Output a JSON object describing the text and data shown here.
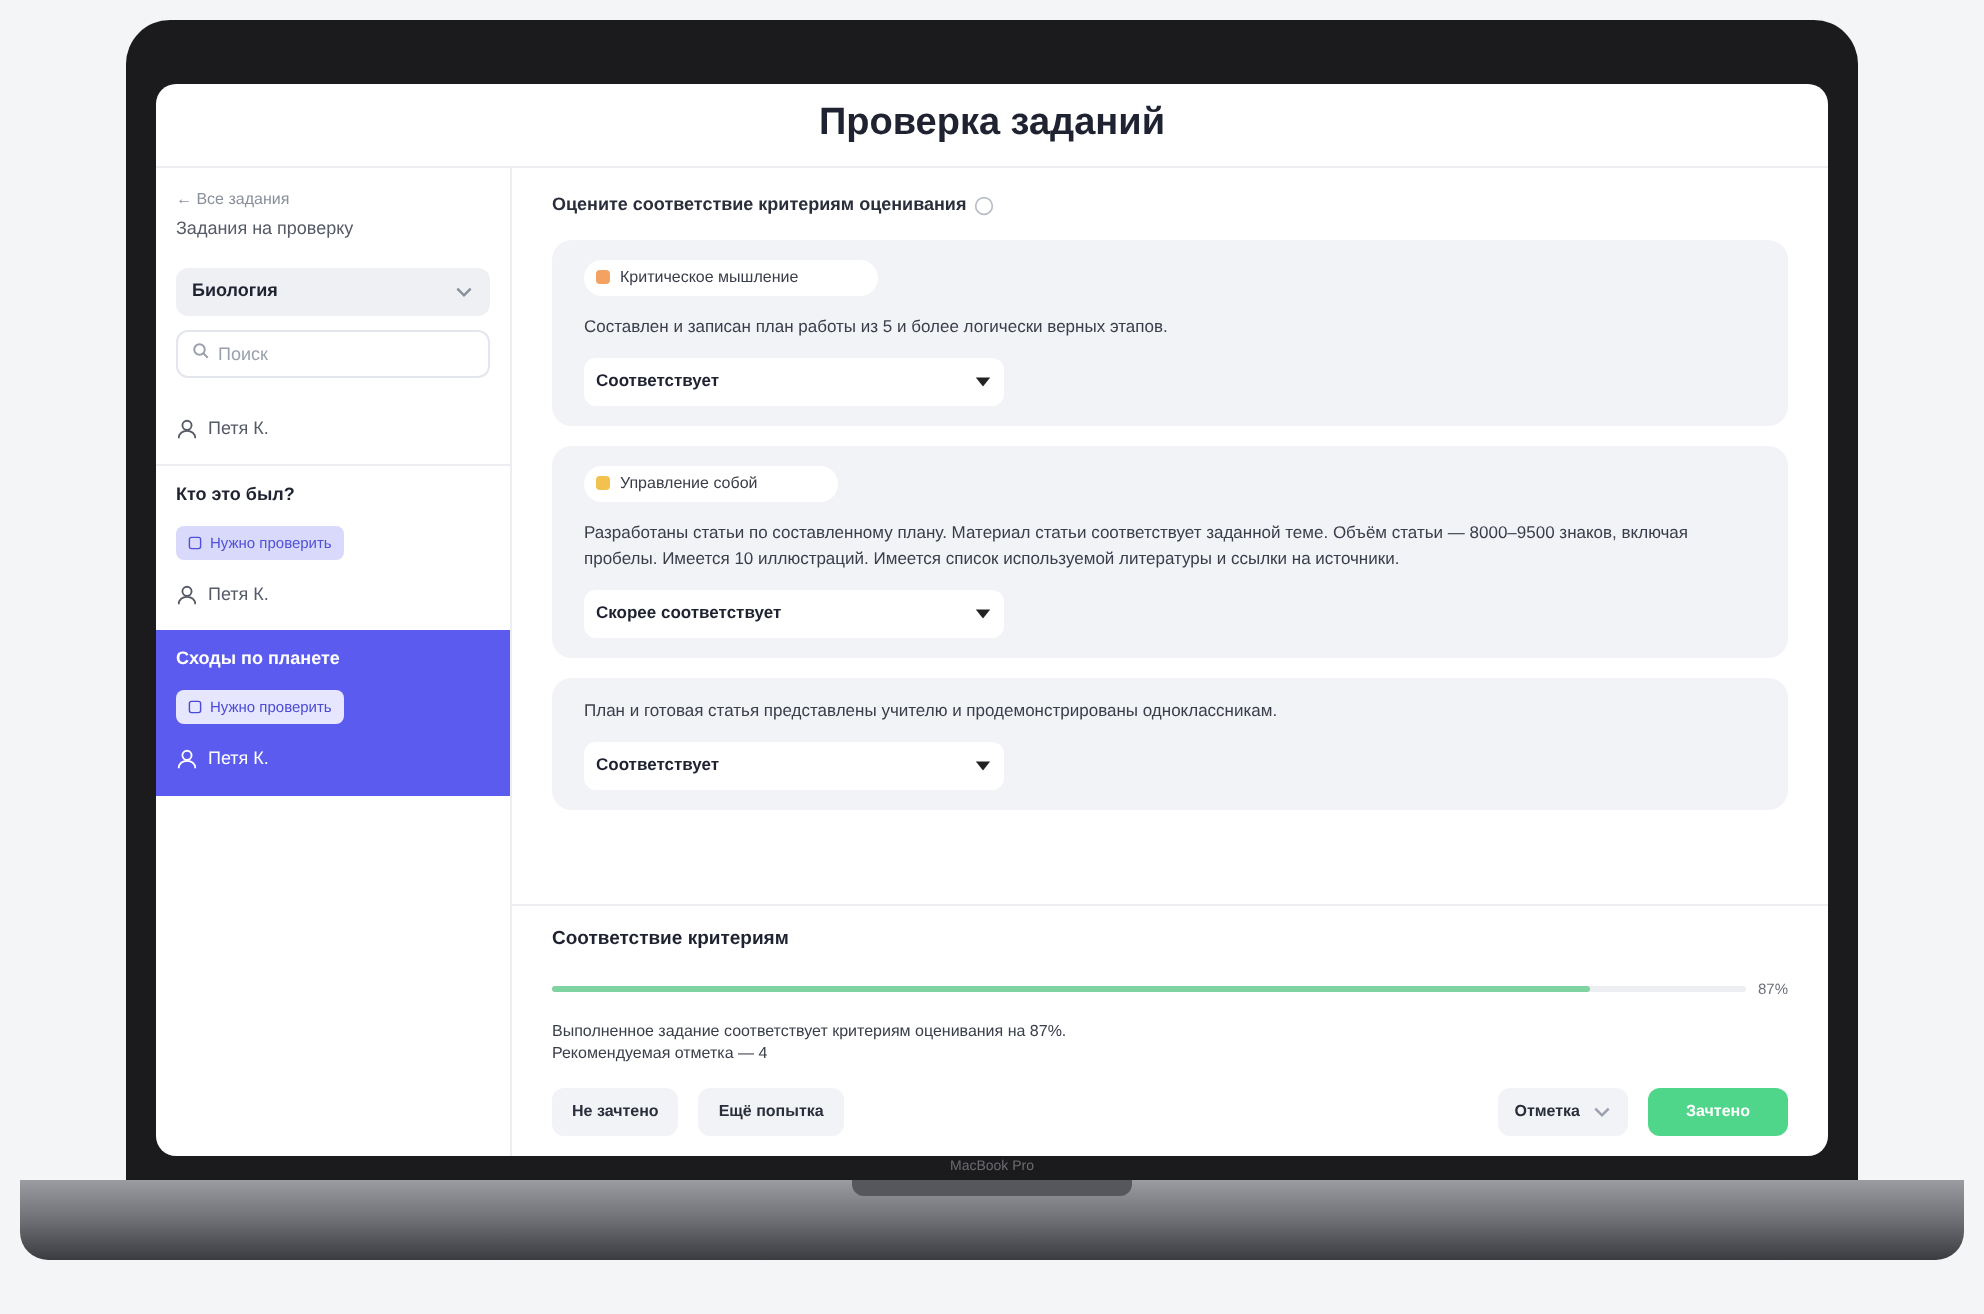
{
  "window": {
    "title": "Проверка заданий"
  },
  "sidebar": {
    "back_link": "← Все задания",
    "subtitle": "Задания на проверку",
    "subject_select": "Биология",
    "search": {
      "placeholder": "Поиск"
    },
    "tasks": [
      {
        "student": "Петя К.",
        "selected": false
      },
      {
        "title": "Кто это был?",
        "status": "Нужно проверить",
        "student": "Петя К.",
        "selected": false
      },
      {
        "title": "Сходы по планете",
        "status": "Нужно проверить",
        "student": "Петя К.",
        "selected": true
      }
    ]
  },
  "main": {
    "heading": "Оцените соответствие критериям оценивания",
    "criteria": [
      {
        "tag": "Критическое мышление",
        "color": "#f4a261",
        "text": "Составлен и записан план работы из 5 и более логически верных этапов.",
        "rating": "Соответствует"
      },
      {
        "tag": "Управление собой",
        "color": "#f2c14e",
        "text": "Разработаны статьи по составленному плану. Материал статьи соответствует заданной теме. Объём статьи — 8000–9500 знаков, включая пробелы. Имеется 10 иллюстраций. Имеется список используемой литературы и ссылки на источники.",
        "rating": "Скорее соответствует"
      },
      {
        "text": "План и готовая статья представлены учителю и продемонстрированы одноклассникам.",
        "rating": "Соответствует"
      }
    ]
  },
  "summary": {
    "title": "Соответствие критериям",
    "level": 0.87,
    "reading": "87%",
    "lines": [
      "Выполненное задание соответствует критериям оценивания на 87%.",
      "Рекомендуемая отметка — 4"
    ],
    "buttons": [
      "Не зачтено",
      "Ещё попытка"
    ],
    "grade_select": "Отметка",
    "submit": "Зачтено"
  },
  "device": {
    "label": "MacBook Pro"
  }
}
